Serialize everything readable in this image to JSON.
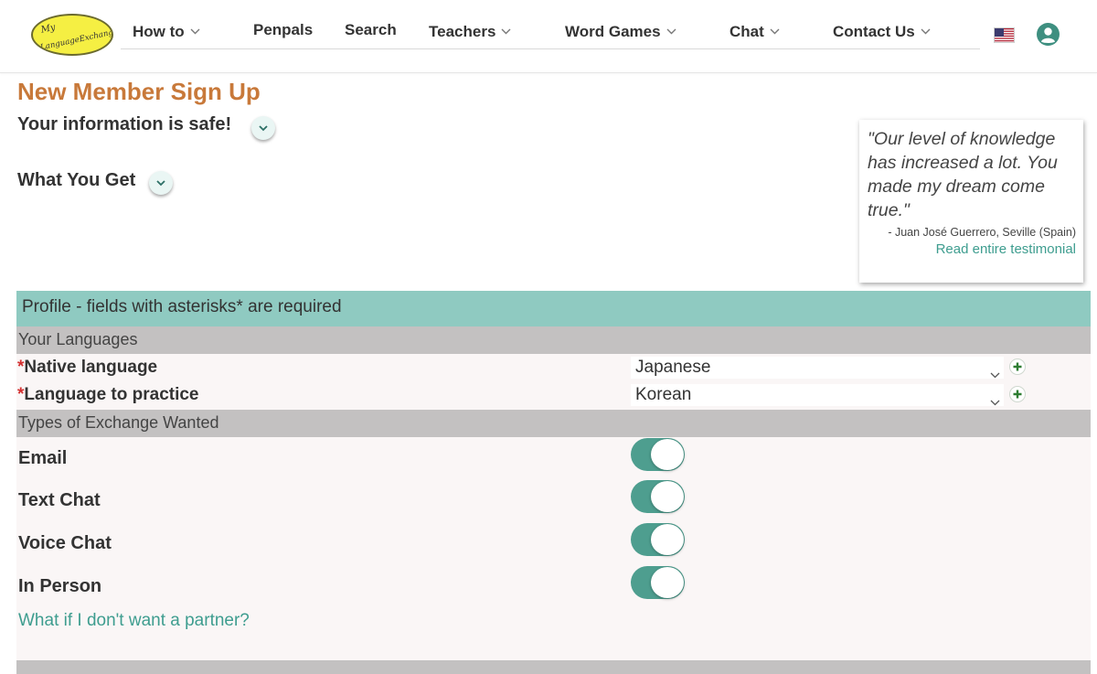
{
  "header": {
    "logo_text": "MyLanguageExchange.com",
    "nav": [
      {
        "label": "How to",
        "has_dropdown": true
      },
      {
        "label": "Penpals",
        "has_dropdown": false
      },
      {
        "label": "Search",
        "has_dropdown": false
      },
      {
        "label": "Teachers",
        "has_dropdown": true
      },
      {
        "label": "Word Games",
        "has_dropdown": true
      },
      {
        "label": "Chat",
        "has_dropdown": true
      },
      {
        "label": "Contact Us",
        "has_dropdown": true
      }
    ],
    "flag_icon": "us-flag-icon",
    "user_icon": "user-account-icon"
  },
  "page": {
    "title": "New Member Sign Up",
    "info_safe": "Your information is safe!",
    "what_you_get": "What You Get"
  },
  "testimonial": {
    "quote": "\"Our level of knowledge has increased a lot. You made my dream come true.\"",
    "author": "- Juan José Guerrero, Seville (Spain)",
    "link": "Read entire testimonial"
  },
  "form": {
    "profile_header": "Profile - fields with asterisks* are required",
    "languages_section": "Your Languages",
    "asterisk": "*",
    "native_label": "Native language",
    "native_value": "Japanese",
    "practice_label": "Language to practice",
    "practice_value": "Korean",
    "exchange_section": "Types of Exchange Wanted",
    "exchange_types": [
      {
        "label": "Email",
        "enabled": true
      },
      {
        "label": "Text Chat",
        "enabled": true
      },
      {
        "label": "Voice Chat",
        "enabled": true
      },
      {
        "label": "In Person",
        "enabled": true
      }
    ],
    "partner_link": "What if I don't want a partner?"
  },
  "colors": {
    "title_orange": "#c8793a",
    "teal_link": "#3e9d8f",
    "profile_bar": "#8fcac1",
    "section_bar": "#c3c1c1",
    "toggle_on": "#4e9e8f",
    "logo_yellow": "#f5ef43"
  }
}
